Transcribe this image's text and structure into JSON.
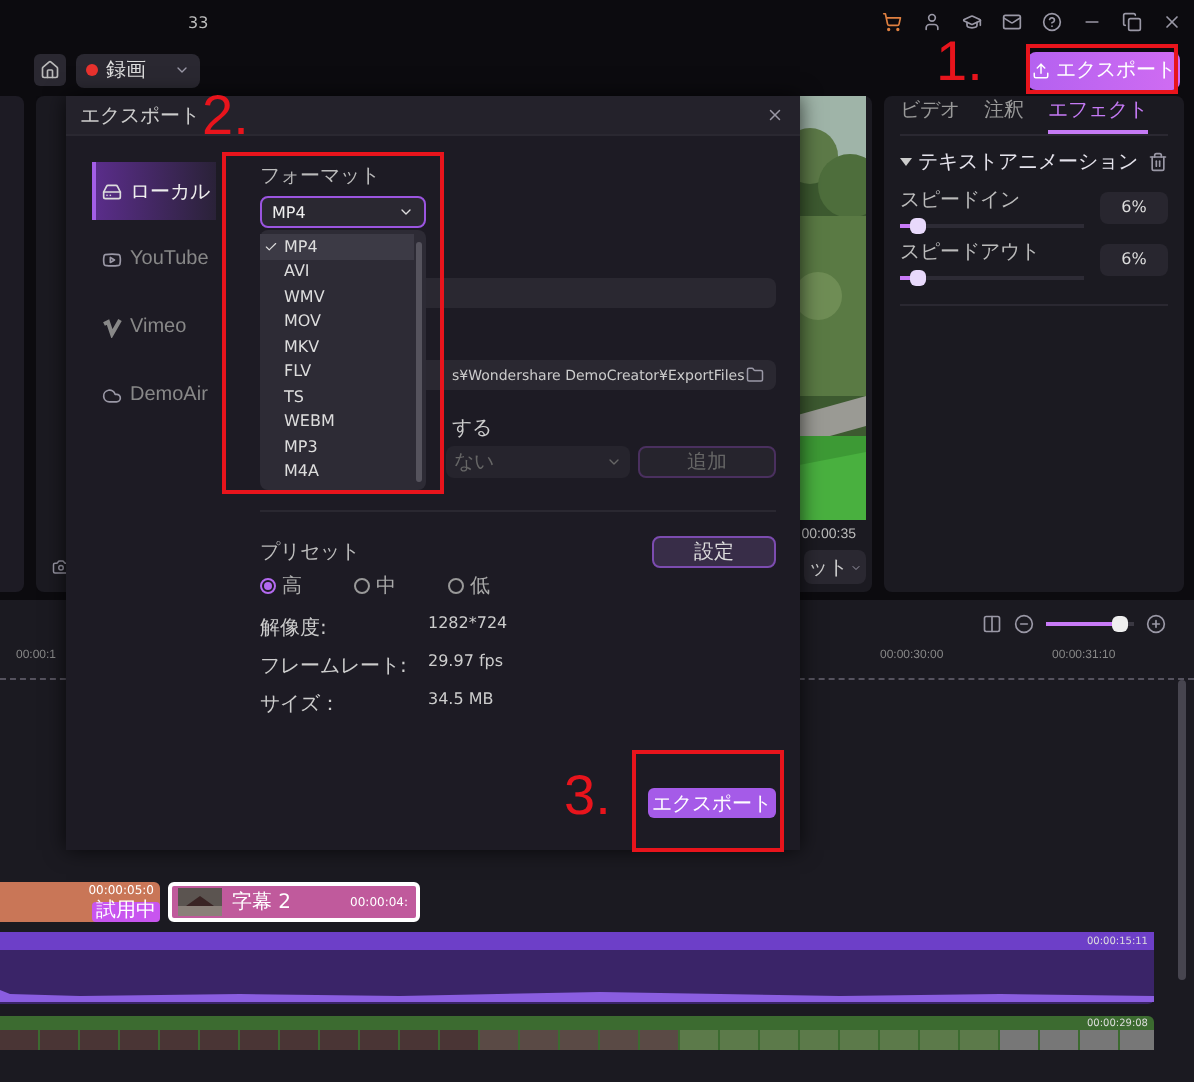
{
  "top_bar": {
    "counter": "33"
  },
  "toolbar": {
    "record_label": "録画",
    "export_button": "エクスポート"
  },
  "preview": {
    "time": "00:00:35",
    "mode_label": "ット"
  },
  "right_panel": {
    "tabs": [
      {
        "label": "ビデオ",
        "selected": false
      },
      {
        "label": "注釈",
        "selected": false
      },
      {
        "label": "エフェクト",
        "selected": true
      }
    ],
    "section": {
      "title": "テキストアニメーション",
      "expanded": true
    },
    "sliders": [
      {
        "label": "スピードイン",
        "level": 0.1,
        "value": "6%"
      },
      {
        "label": "スピードアウト",
        "level": 0.1,
        "value": "6%"
      }
    ]
  },
  "dialog": {
    "title": "エクスポート",
    "nav": [
      {
        "label": "ローカル",
        "selected": true,
        "kind": "local"
      },
      {
        "label": "YouTube",
        "selected": false,
        "kind": "youtube"
      },
      {
        "label": "Vimeo",
        "selected": false,
        "kind": "vimeo"
      },
      {
        "label": "DemoAir",
        "selected": false,
        "kind": "cloud"
      }
    ],
    "format": {
      "label": "フォーマット",
      "value": "MP4",
      "expanded": true,
      "options": [
        {
          "label": "MP4",
          "selected": true
        },
        {
          "label": "AVI",
          "selected": false
        },
        {
          "label": "WMV",
          "selected": false
        },
        {
          "label": "MOV",
          "selected": false
        },
        {
          "label": "MKV",
          "selected": false
        },
        {
          "label": "FLV",
          "selected": false
        },
        {
          "label": "TS",
          "selected": false
        },
        {
          "label": "WEBM",
          "selected": false
        },
        {
          "label": "MP3",
          "selected": false
        },
        {
          "label": "M4A",
          "selected": false
        }
      ]
    },
    "path": "s¥Wondershare DemoCreator¥ExportFiles",
    "option_text": "する",
    "preset_select": "ない",
    "add_button": {
      "label": "追加",
      "disabled": true
    },
    "preset": {
      "label": "プリセット",
      "settings_button": "設定",
      "qualities": [
        {
          "label": "高",
          "selected": true
        },
        {
          "label": "中",
          "selected": false
        },
        {
          "label": "低",
          "selected": false
        }
      ]
    },
    "info": [
      {
        "label": "解像度:",
        "value": "1282*724"
      },
      {
        "label": "フレームレート:",
        "value": "29.97 fps"
      },
      {
        "label": "サイズ：",
        "value": "34.5 MB"
      }
    ],
    "export_button": "エクスポート"
  },
  "timeline": {
    "zoom": {
      "level": 0.85
    },
    "ruler": [
      "00:00:1",
      "00:00:30:00",
      "00:00:31:10"
    ],
    "clips": [
      {
        "kind": "effect",
        "time": "00:00:05:0",
        "badge": "試用中"
      },
      {
        "kind": "caption",
        "title": "字幕 2",
        "time": "00:00:04:"
      }
    ],
    "tracks": [
      {
        "kind": "audio",
        "time": "00:00:15:11"
      },
      {
        "kind": "video",
        "time": "00:00:29:08"
      }
    ]
  },
  "annotations": [
    {
      "label": "1."
    },
    {
      "label": "2."
    },
    {
      "label": "3."
    }
  ]
}
